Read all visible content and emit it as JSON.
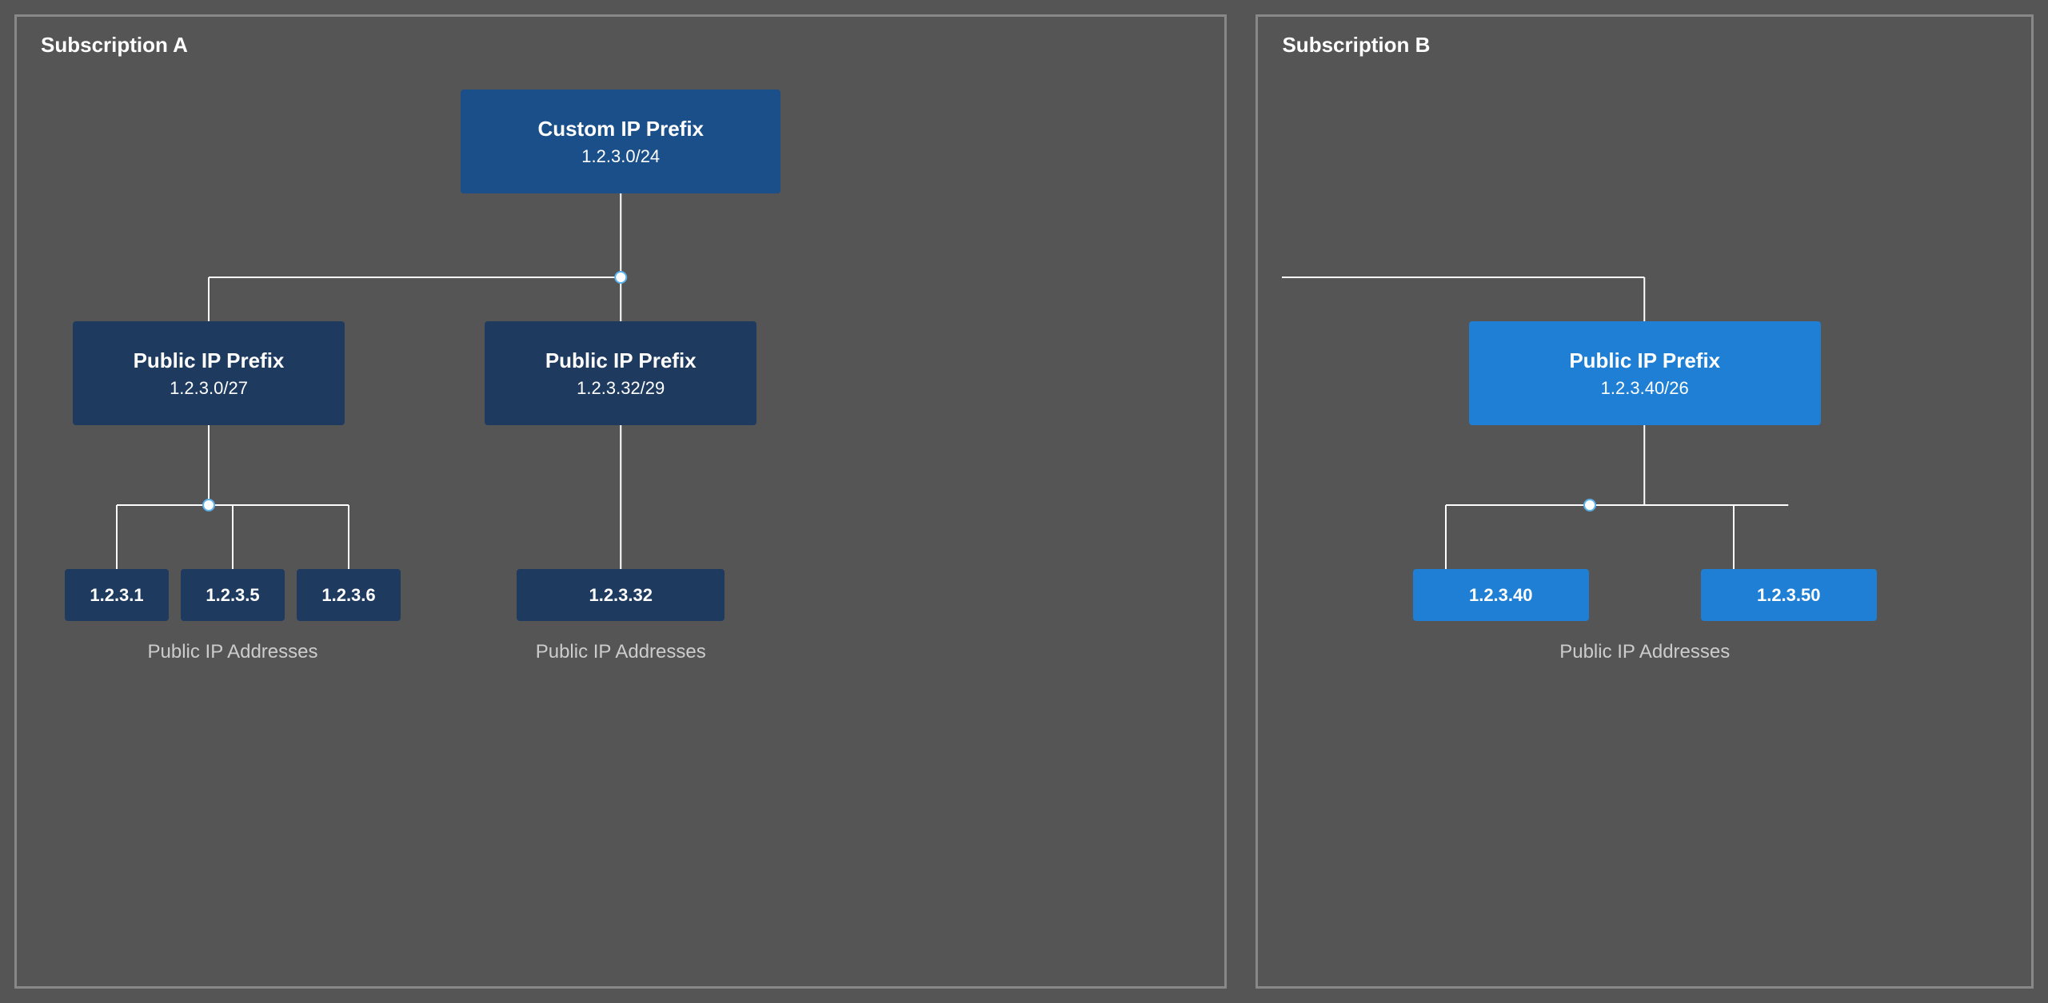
{
  "subscriptionA": {
    "label": "Subscription A",
    "customIpPrefix": {
      "title": "Custom IP Prefix",
      "subtitle": "1.2.3.0/24"
    },
    "prefixLeft": {
      "title": "Public IP Prefix",
      "subtitle": "1.2.3.0/27"
    },
    "prefixCenter": {
      "title": "Public IP Prefix",
      "subtitle": "1.2.3.32/29"
    },
    "ipsLeft": [
      "1.2.3.1",
      "1.2.3.5",
      "1.2.3.6"
    ],
    "ipCenter": "1.2.3.32",
    "captionLeft": "Public IP Addresses",
    "captionCenter": "Public IP Addresses"
  },
  "subscriptionB": {
    "label": "Subscription B",
    "prefixRight": {
      "title": "Public IP Prefix",
      "subtitle": "1.2.3.40/26"
    },
    "ipsRight": [
      "1.2.3.40",
      "1.2.3.50"
    ],
    "captionRight": "Public IP Addresses"
  }
}
